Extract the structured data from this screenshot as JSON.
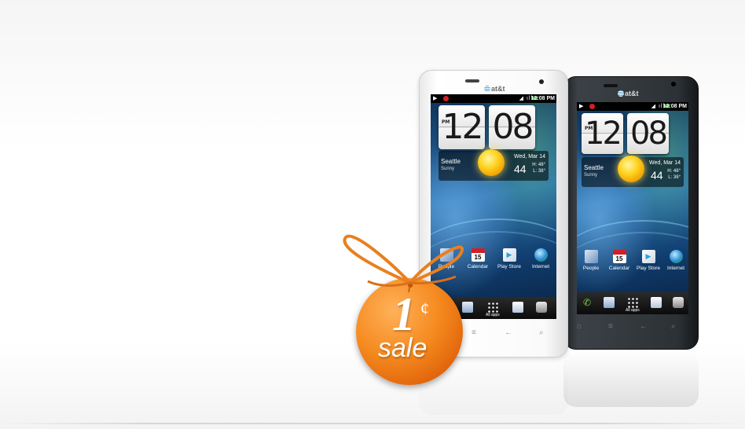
{
  "promo": {
    "price": "1",
    "currency_symbol": "¢",
    "label": "sale",
    "color": "#f58a1f"
  },
  "phones": [
    {
      "finish": "white",
      "brand": "at&t",
      "status_time": "12:08 PM",
      "clock_hour": "12",
      "clock_minute": "08",
      "clock_ampm": "PM",
      "weather": {
        "city": "Seattle",
        "condition": "Sunny",
        "date": "Wed, Mar 14",
        "temp": "44",
        "high": "H: 48°",
        "low": "L: 38°"
      },
      "apps": [
        "People",
        "Calendar",
        "Play Store",
        "Internet"
      ],
      "calendar_day": "15",
      "dock_label": "All apps"
    },
    {
      "finish": "black",
      "brand": "at&t",
      "status_time": "12:08 PM",
      "clock_hour": "12",
      "clock_minute": "08",
      "clock_ampm": "PM",
      "weather": {
        "city": "Seattle",
        "condition": "Sunny",
        "date": "Wed, Mar 14",
        "temp": "44",
        "high": "H: 48°",
        "low": "L: 38°"
      },
      "apps": [
        "People",
        "Calendar",
        "Play Store",
        "Internet"
      ],
      "calendar_day": "15",
      "dock_label": "All apps"
    }
  ],
  "icons": [
    "play-icon",
    "beats-icon",
    "signal-icon",
    "battery-icon",
    "sun-icon",
    "people-icon",
    "calendar-icon",
    "play-store-icon",
    "internet-icon",
    "phone-icon",
    "messages-icon",
    "all-apps-icon",
    "mail-icon",
    "camera-icon",
    "home-icon",
    "menu-icon",
    "back-icon",
    "search-icon"
  ]
}
